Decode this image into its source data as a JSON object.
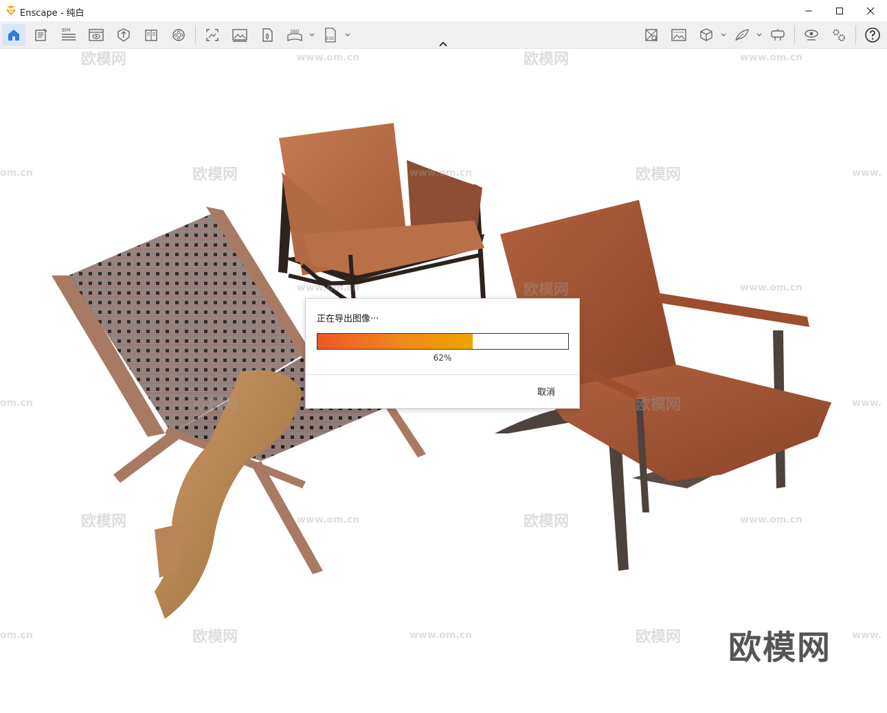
{
  "window": {
    "title": "Enscape - 纯白",
    "controls": [
      "minimize-icon",
      "maximize-icon",
      "close-icon"
    ]
  },
  "toolbar": {
    "left_icons": [
      "home-icon",
      "notes-icon",
      "bim-icon",
      "view-icon",
      "safe-frame-icon",
      "book-icon",
      "film-reel-icon",
      "screenshot-icon",
      "batch-render-icon",
      "export-panorama-icon",
      "panorama-360-icon",
      "exe-export-icon"
    ],
    "bim_label": "BIM",
    "pano_label": "360",
    "exe_label": "EXE",
    "right_icons": [
      "material-editor-icon",
      "atmosphere-icon",
      "asset-library-icon",
      "feather-icon",
      "vr-headset-icon",
      "visual-settings-icon",
      "settings-icon",
      "help-icon"
    ],
    "active": "home-icon"
  },
  "viewport": {
    "watermark_logo": "欧模网",
    "watermark_url": "www.om.cn",
    "watermark_url_partial": "om.cn",
    "watermark_url_edge": "www.",
    "corner_logo": "欧模网"
  },
  "dialog": {
    "message": "正在导出图像···",
    "progress_value": 0.62,
    "progress_text": "62%",
    "cancel_label": "取消",
    "progress_color_start": "#ee5627",
    "progress_color_end": "#f0a300"
  }
}
